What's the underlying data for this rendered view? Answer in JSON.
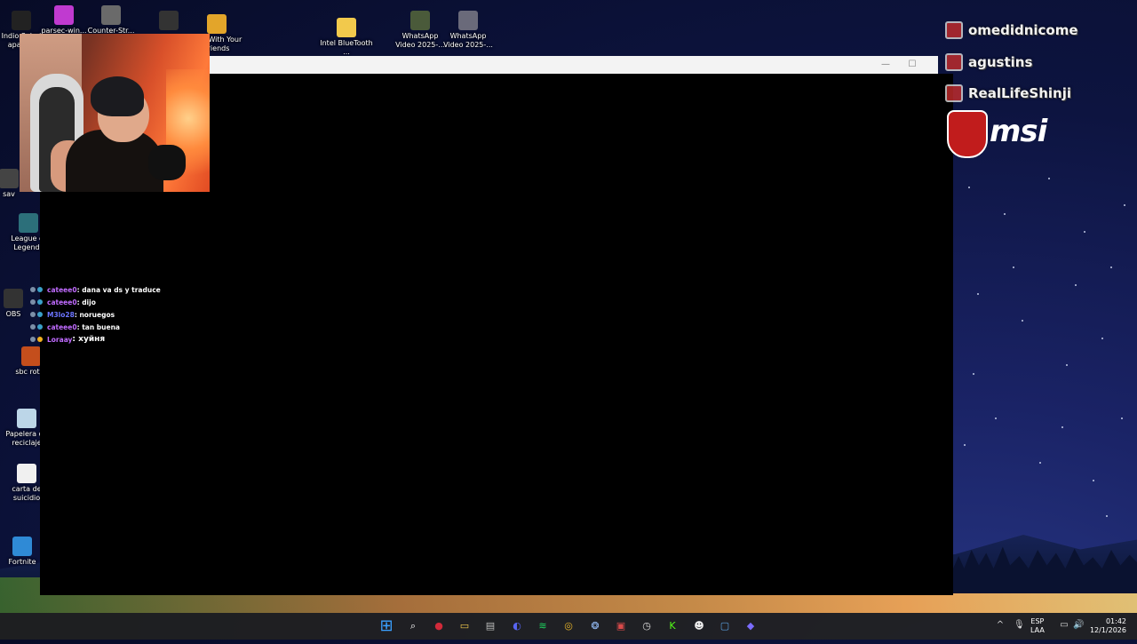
{
  "desktop_icons": [
    {
      "label": "Indio Solari apare...",
      "color": "#222222"
    },
    {
      "label": "parsec-win...",
      "color": "#c03ad0"
    },
    {
      "label": "Counter-Str...",
      "color": "#6a6a6a"
    },
    {
      "label": "",
      "color": "#333333"
    },
    {
      "label": "Golf With Your Friends",
      "color": "#e3a52a"
    },
    {
      "label": "Intel BlueTooth ...",
      "color": "#f2c94c"
    },
    {
      "label": "WhatsApp Video 2025-...",
      "color": "#4a5a3a"
    },
    {
      "label": "WhatsApp Video 2025-...",
      "color": "#6a6a7a"
    },
    {
      "label": "sav",
      "color": "#444444"
    },
    {
      "label": "League of Legends",
      "color": "#2c6f7a"
    },
    {
      "label": "OBS",
      "color": "#333333"
    },
    {
      "label": "sbc rotat",
      "color": "#c44e1c"
    },
    {
      "label": "Papelera de reciclaje",
      "color": "#bcd6e8"
    },
    {
      "label": "carta de suicidio",
      "color": "#f0f0f0"
    },
    {
      "label": "Fortnite",
      "color": "#2f8ad6"
    }
  ],
  "window": {
    "minimize": "—",
    "maximize": "☐"
  },
  "chat": [
    {
      "user": "cateee0",
      "message": ": dana va ds y traduce",
      "color": "#c06bff"
    },
    {
      "user": "cateee0",
      "message": ": dijo",
      "color": "#c06bff"
    },
    {
      "user": "M3lo28",
      "message": ": noruegos",
      "color": "#6b74ff"
    },
    {
      "user": "cateee0",
      "message": ": tan buena",
      "color": "#c06bff"
    },
    {
      "user": "Loraay",
      "message": ": хуйня",
      "color": "#c06bff"
    }
  ],
  "overlay_names": [
    "omedidnicome",
    "agustins",
    "RealLifeShinji"
  ],
  "brand": "msi",
  "taskbar_icons": [
    {
      "name": "windows-start-icon",
      "glyph": "⊞",
      "color": "#3aa0ff"
    },
    {
      "name": "search-icon",
      "glyph": "⌕",
      "color": "#ffffff"
    },
    {
      "name": "app-red-icon",
      "glyph": "●",
      "color": "#d12a3a"
    },
    {
      "name": "file-explorer-icon",
      "glyph": "▭",
      "color": "#f2c94c"
    },
    {
      "name": "app-gray-icon",
      "glyph": "▤",
      "color": "#bbbbbb"
    },
    {
      "name": "discord-icon",
      "glyph": "◐",
      "color": "#5865f2"
    },
    {
      "name": "spotify-icon",
      "glyph": "≋",
      "color": "#1ed760"
    },
    {
      "name": "chrome-icon",
      "glyph": "◎",
      "color": "#e8b52a"
    },
    {
      "name": "app-blue-icon",
      "glyph": "❂",
      "color": "#9ac3ff"
    },
    {
      "name": "video-app-icon",
      "glyph": "▣",
      "color": "#d94a4a"
    },
    {
      "name": "app-clock-icon",
      "glyph": "◷",
      "color": "#dddddd"
    },
    {
      "name": "kick-icon",
      "glyph": "K",
      "color": "#53fc18"
    },
    {
      "name": "app-face-icon",
      "glyph": "☻",
      "color": "#eeeeee"
    },
    {
      "name": "app-window-icon",
      "glyph": "▢",
      "color": "#5aa0e0"
    },
    {
      "name": "app-diamond-icon",
      "glyph": "◆",
      "color": "#7b6cff"
    }
  ],
  "tray": {
    "chevron": "^",
    "lang_top": "ESP",
    "lang_bottom": "LAA",
    "time": "01:42",
    "date": "12/1/2026"
  }
}
